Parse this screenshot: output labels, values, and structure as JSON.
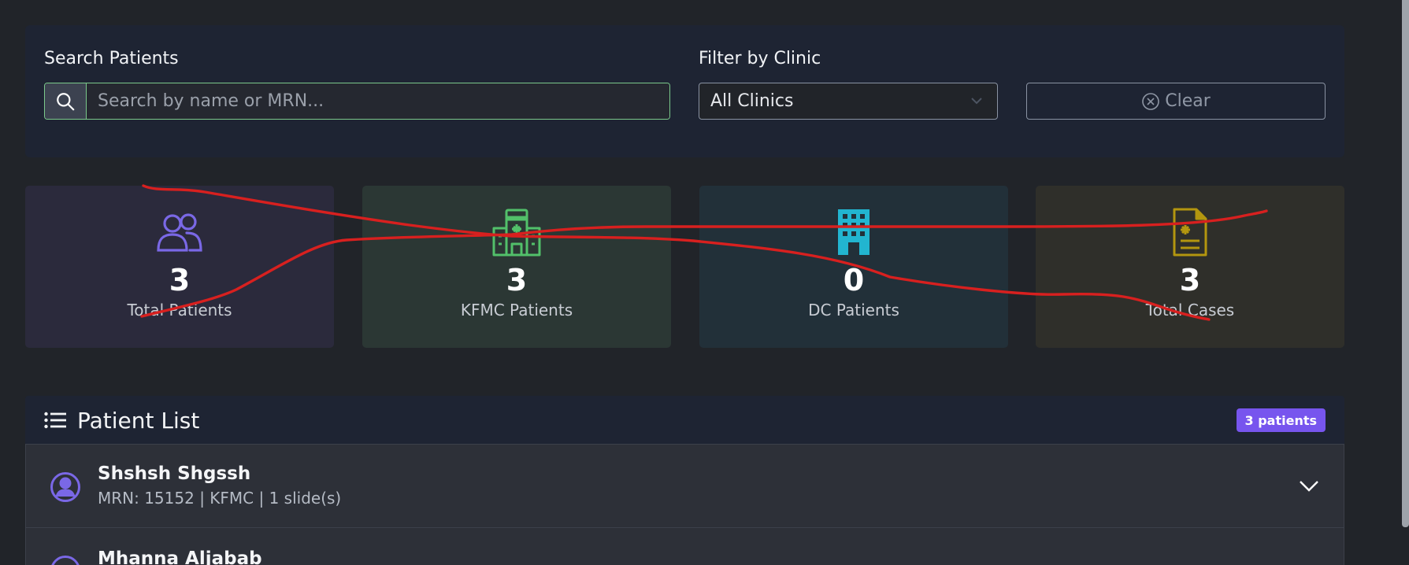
{
  "filters": {
    "search_label": "Search Patients",
    "search_placeholder": "Search by name or MRN...",
    "clinic_label": "Filter by Clinic",
    "clinic_selected": "All Clinics",
    "clear_label": "Clear"
  },
  "stats": [
    {
      "value": "3",
      "label": "Total Patients",
      "icon": "users-icon",
      "color": "#7a68e6"
    },
    {
      "value": "3",
      "label": "KFMC Patients",
      "icon": "hospital-icon",
      "color": "#52c06a"
    },
    {
      "value": "0",
      "label": "DC Patients",
      "icon": "building-icon",
      "color": "#22b5d0"
    },
    {
      "value": "3",
      "label": "Total Cases",
      "icon": "document-medical-icon",
      "color": "#b3960f"
    }
  ],
  "patient_list": {
    "title": "Patient List",
    "badge": "3 patients",
    "patients": [
      {
        "name": "Shshsh Shgssh",
        "meta": "MRN: 15152 | KFMC | 1 slide(s)"
      },
      {
        "name": "Mhanna Aljabab",
        "meta": ""
      }
    ]
  },
  "colors": {
    "accent": "#7755ee",
    "annotation": "#d8201f"
  }
}
